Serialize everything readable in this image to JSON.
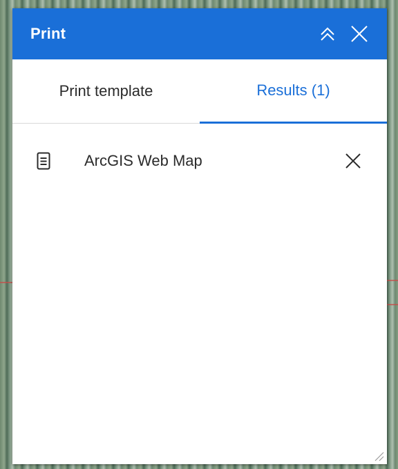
{
  "panel": {
    "title": "Print",
    "collapse_icon": "chevrons-up-icon",
    "close_icon": "close-icon"
  },
  "tabs": [
    {
      "label": "Print template",
      "active": false
    },
    {
      "label": "Results (1)",
      "active": true
    }
  ],
  "results": [
    {
      "label": "ArcGIS Web Map",
      "icon": "document-icon",
      "remove_icon": "close-icon"
    }
  ],
  "colors": {
    "accent": "#1a6fd8",
    "text": "#2b2b2b",
    "header_text": "#ffffff"
  }
}
